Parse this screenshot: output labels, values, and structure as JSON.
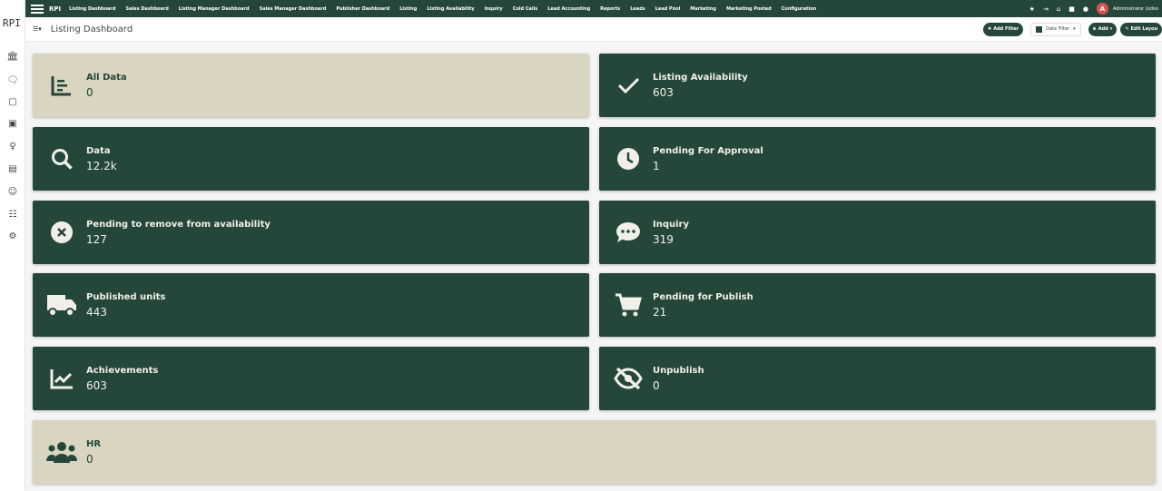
{
  "app": {
    "brand": "RPI",
    "sidebar_logo": "RPI",
    "menu": [
      "Listing Dashboard",
      "Sales Dashboard",
      "Listing Manager Dashboard",
      "Sales Manager Dashboard",
      "Publisher Dashboard",
      "Listing",
      "Listing Availability",
      "Inquiry",
      "Cold Calls",
      "Lead Accounting",
      "Reports",
      "Leads",
      "Lead Pool",
      "Marketing",
      "Marketing Posted",
      "Configuration"
    ],
    "user_initial": "A",
    "user_name": "Administrator (odoo"
  },
  "subbar": {
    "title": "Listing Dashboard",
    "add_filter": "Add Filter",
    "date_filter": "Date Filter",
    "add": "Add",
    "edit_layout": "Edit Layou"
  },
  "cards": [
    {
      "label": "All Data",
      "value": "0",
      "icon": "bar-list-icon",
      "style": "light"
    },
    {
      "label": "Listing Availability",
      "value": "603",
      "icon": "check-icon",
      "style": "dark"
    },
    {
      "label": "Data",
      "value": "12.2k",
      "icon": "search-icon",
      "style": "dark"
    },
    {
      "label": "Pending For Approval",
      "value": "1",
      "icon": "clock-icon",
      "style": "dark"
    },
    {
      "label": "Pending to remove from availability",
      "value": "127",
      "icon": "x-circle-icon",
      "style": "dark"
    },
    {
      "label": "Inquiry",
      "value": "319",
      "icon": "chat-icon",
      "style": "dark"
    },
    {
      "label": "Published units",
      "value": "443",
      "icon": "truck-icon",
      "style": "dark"
    },
    {
      "label": "Pending for Publish",
      "value": "21",
      "icon": "cart-icon",
      "style": "dark"
    },
    {
      "label": "Achievements",
      "value": "603",
      "icon": "line-chart-icon",
      "style": "dark"
    },
    {
      "label": "Unpublish",
      "value": "0",
      "icon": "eye-slash-icon",
      "style": "dark"
    },
    {
      "label": "HR",
      "value": "0",
      "icon": "users-icon",
      "style": "light"
    }
  ],
  "colors": {
    "primary": "#25473a",
    "light_card": "#d9d5c1",
    "card_text": "#f0f0e8"
  }
}
